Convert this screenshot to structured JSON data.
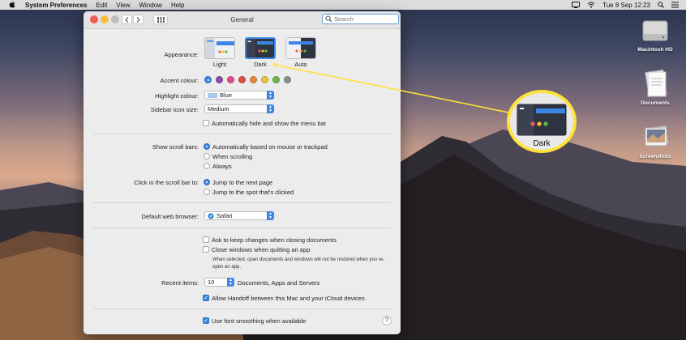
{
  "menubar": {
    "app_name": "System Preferences",
    "items": [
      "Edit",
      "View",
      "Window",
      "Help"
    ],
    "clock": "Tue 8 Sep  12:23"
  },
  "desktop": {
    "icons": [
      {
        "label": "Macintosh HD",
        "icon": "hard-drive-icon"
      },
      {
        "label": "Documents",
        "icon": "folder-icon"
      },
      {
        "label": "Screenshots",
        "icon": "folder-icon"
      }
    ]
  },
  "window": {
    "title": "General",
    "search": {
      "placeholder": "Search",
      "value": ""
    }
  },
  "appearance": {
    "label": "Appearance:",
    "options": [
      {
        "label": "Light",
        "selected": false
      },
      {
        "label": "Dark",
        "selected": true
      },
      {
        "label": "Auto",
        "selected": false
      }
    ]
  },
  "accent": {
    "label": "Accent colour:",
    "colors": [
      "#3b86e4",
      "#8e4aa9",
      "#e04c91",
      "#e14b4b",
      "#e7873b",
      "#e8c33c",
      "#6bb64f",
      "#8e8e8e"
    ],
    "selected_index": 0
  },
  "highlight": {
    "label": "Highlight colour:",
    "value": "Blue",
    "swatch_color": "#a9c8ef"
  },
  "sidebar": {
    "label": "Sidebar icon size:",
    "value": "Medium"
  },
  "autohide": {
    "label": "Automatically hide and show the menu bar",
    "checked": false
  },
  "scrollbars": {
    "label": "Show scroll bars:",
    "options": [
      "Automatically based on mouse or trackpad",
      "When scrolling",
      "Always"
    ],
    "selected_index": 0
  },
  "scrollclick": {
    "label": "Click in the scroll bar to:",
    "options": [
      "Jump to the next page",
      "Jump to the spot that's clicked"
    ],
    "selected_index": 0
  },
  "browser": {
    "label": "Default web browser:",
    "value": "Safari"
  },
  "documents": {
    "ask_keep": {
      "label": "Ask to keep changes when closing documents",
      "checked": false
    },
    "close_windows": {
      "label": "Close windows when quitting an app",
      "checked": false
    },
    "note": "When selected, open documents and windows will not be restored when you re-open an app."
  },
  "recent": {
    "label": "Recent items:",
    "value": "10",
    "suffix": "Documents, Apps and Servers"
  },
  "handoff": {
    "label": "Allow Handoff between this Mac and your iCloud devices",
    "checked": true
  },
  "smoothing": {
    "label": "Use font smoothing when available",
    "checked": true
  },
  "help_label": "?",
  "callout": {
    "label": "Dark",
    "accent_color": "#ffe23b"
  }
}
